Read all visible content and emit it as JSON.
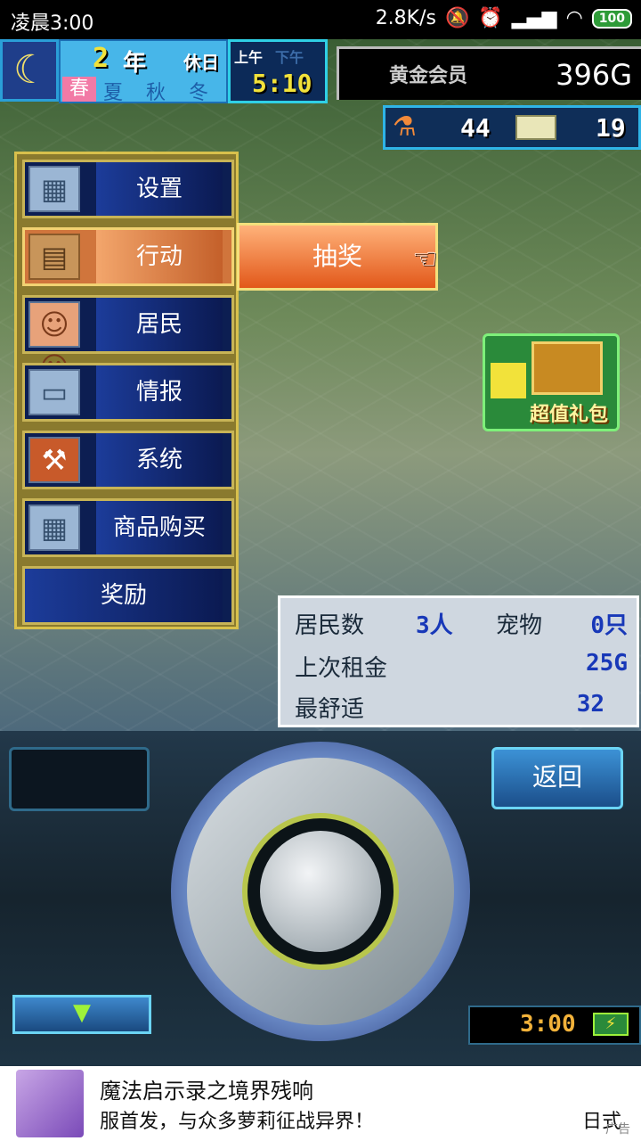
{
  "status_bar": {
    "time": "凌晨3:00",
    "speed": "2.8K/s",
    "battery": "100"
  },
  "hud": {
    "year_number": "2",
    "year_unit": "年",
    "weekday": "休日",
    "season_current": "春",
    "seasons_other": [
      "夏",
      "秋",
      "冬"
    ],
    "am_label": "上午",
    "pm_label": "下午",
    "clock": "5:10",
    "member_label": "黄金会员",
    "gold": "396G",
    "research_points": "44",
    "tickets": "19"
  },
  "menu": {
    "items": [
      {
        "label": "设置",
        "icon": "building-icon"
      },
      {
        "label": "行动",
        "icon": "briefcase-icon"
      },
      {
        "label": "居民",
        "icon": "residents-icon"
      },
      {
        "label": "情报",
        "icon": "computer-icon"
      },
      {
        "label": "系统",
        "icon": "toolbox-icon"
      },
      {
        "label": "商品购买",
        "icon": "building-icon"
      },
      {
        "label": "奖励",
        "icon": ""
      }
    ],
    "submenu_item": "抽奖"
  },
  "gift_pack": {
    "label": "超值礼包"
  },
  "stats": {
    "residents_label": "居民数",
    "residents_value": "3人",
    "pets_label": "宠物",
    "pets_value": "0只",
    "last_rent_label": "上次租金",
    "last_rent_value": "25G",
    "comfort_label": "最舒适",
    "comfort_value": "32"
  },
  "controls": {
    "back_label": "返回",
    "mini_clock": "3:00"
  },
  "ad": {
    "title": "魔法启示录之境界残响",
    "subtitle": "服首发，与众多萝莉征战异界！",
    "tag_left": "日式",
    "tag_right": "广告"
  }
}
